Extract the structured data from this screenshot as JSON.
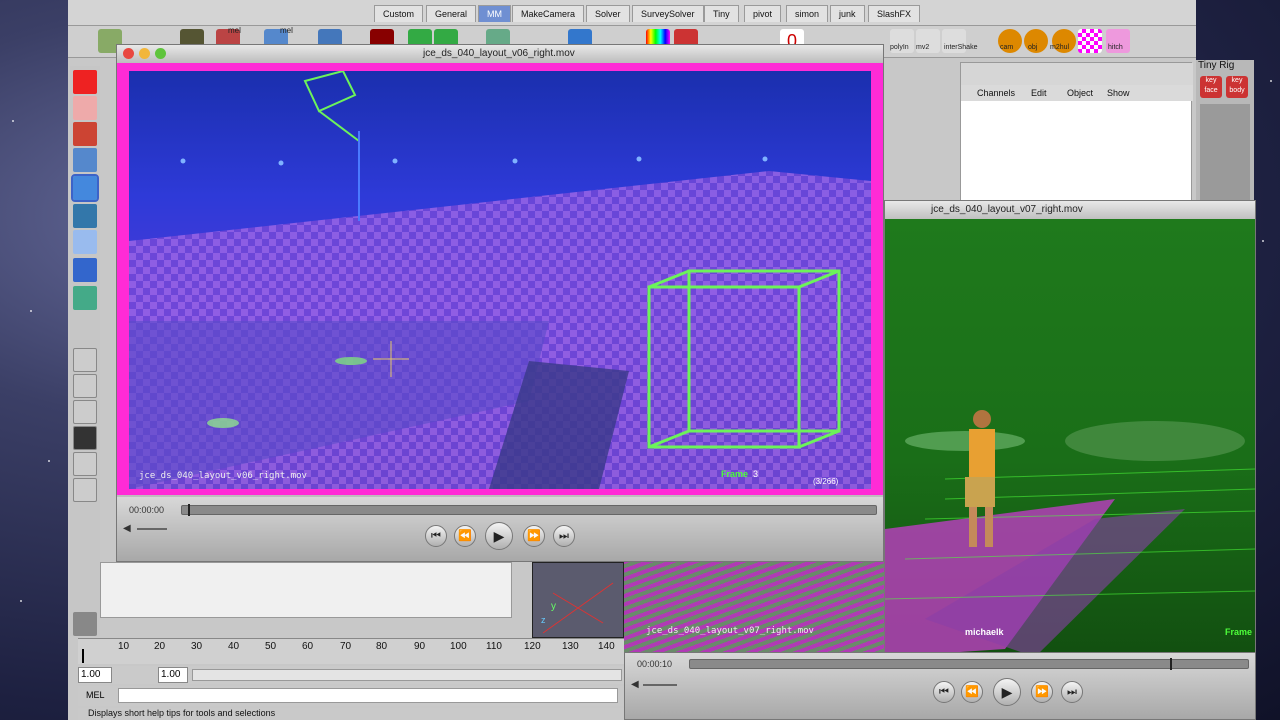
{
  "maya": {
    "shelf_tabs": [
      "Custom",
      "General",
      "MM",
      "MakeCamera",
      "Solver",
      "SurveySolver",
      "Tiny",
      "pivot",
      "simon",
      "junk",
      "SlashFX"
    ],
    "active_tab": "MM",
    "shelf_labels": [
      "mel",
      "mel",
      "polyIn",
      "mv2",
      "interShake",
      "cam",
      "obj",
      "m2hul",
      "hitch"
    ],
    "channel_box_menu": [
      "Channels",
      "Edit",
      "Object",
      "Show"
    ],
    "tiny_rig_title": "Tiny Rig",
    "tiny_rig_buttons": [
      "key face",
      "key body"
    ],
    "timeline_ticks": [
      "10",
      "20",
      "30",
      "40",
      "50",
      "60",
      "70",
      "80",
      "90",
      "100",
      "110",
      "120",
      "130",
      "140"
    ],
    "range_start": "1.00",
    "range_current": "1.00",
    "mel_label": "MEL",
    "help_text": "Displays short help tips for tools and selections"
  },
  "qt1": {
    "title": "jce_ds_040_layout_v06_right.mov",
    "burn_in_left": "jce_ds_040_layout_v06_right.mov",
    "frame_label": "Frame",
    "frame_number": "3",
    "frame_count": "(3/266)",
    "timecode": "00:00:00",
    "playhead_fraction": 0.008
  },
  "qt2": {
    "title": "jce_ds_040_layout_v07_right.mov",
    "burn_in_left": "jce_ds_040_layout_v07_right.mov",
    "artist_label": "michaelk",
    "frame_label": "Frame",
    "timecode": "00:00:10",
    "playhead_fraction": 0.86
  },
  "colors": {
    "magenta_border": "#ff2bd6",
    "active_tab": "#6f8fd2",
    "wire_green": "#6cf35a"
  }
}
